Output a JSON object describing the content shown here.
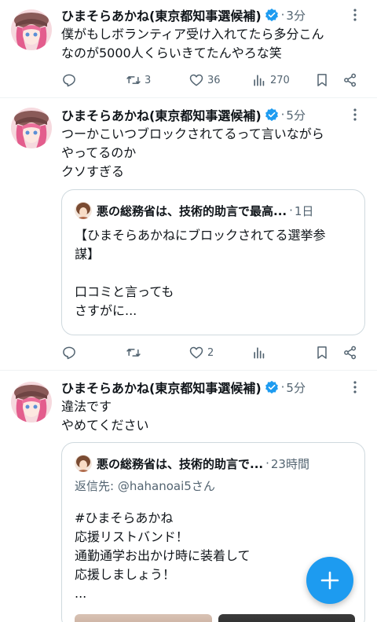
{
  "tweets": [
    {
      "author": "ひまそらあかね(東京都知事選候補)",
      "dot": "·",
      "time": "3分",
      "lines": [
        "僕がもしボランティア受け入れてたら多分こん",
        "なのが5000人くらいきてたんやろな笑"
      ],
      "actions": {
        "reply": "",
        "retweet": "3",
        "like": "36",
        "views": "270"
      }
    },
    {
      "author": "ひまそらあかね(東京都知事選候補)",
      "dot": "·",
      "time": "5分",
      "lines": [
        "つーかこいつブロックされてるって言いながら",
        "やってるのか",
        "クソすぎる"
      ],
      "quote": {
        "author": "悪の総務省は、技術的助言で最高...",
        "dot": "·",
        "time": "1日",
        "lines": [
          "【ひまそらあかねにブロックされてる選挙参",
          "謀】",
          "",
          "口コミと言っても",
          "さすがに..."
        ]
      },
      "actions": {
        "reply": "",
        "retweet": "",
        "like": "2",
        "views": ""
      }
    },
    {
      "author": "ひまそらあかね(東京都知事選候補)",
      "dot": "·",
      "time": "5分",
      "lines": [
        "違法です",
        "やめてください"
      ],
      "quote": {
        "author": "悪の総務省は、技術的助言で...",
        "dot": "·",
        "time": "23時間",
        "reply_prefix": "返信先:",
        "reply_handle": "@hahanoai5さん",
        "lines": [
          "#ひまそらあかね",
          "応援リストバンド！",
          "通勤通学お出かけ時に装着して",
          "応援しましょう！",
          "..."
        ]
      }
    }
  ],
  "colors": {
    "accent": "#1d9bf0",
    "muted": "#536471",
    "text": "#0f1419",
    "border": "#cfd9de"
  },
  "icons": [
    "verified-badge-icon",
    "more-icon",
    "reply-icon",
    "retweet-icon",
    "like-icon",
    "views-icon",
    "bookmark-icon",
    "share-icon",
    "compose-plus-icon"
  ]
}
